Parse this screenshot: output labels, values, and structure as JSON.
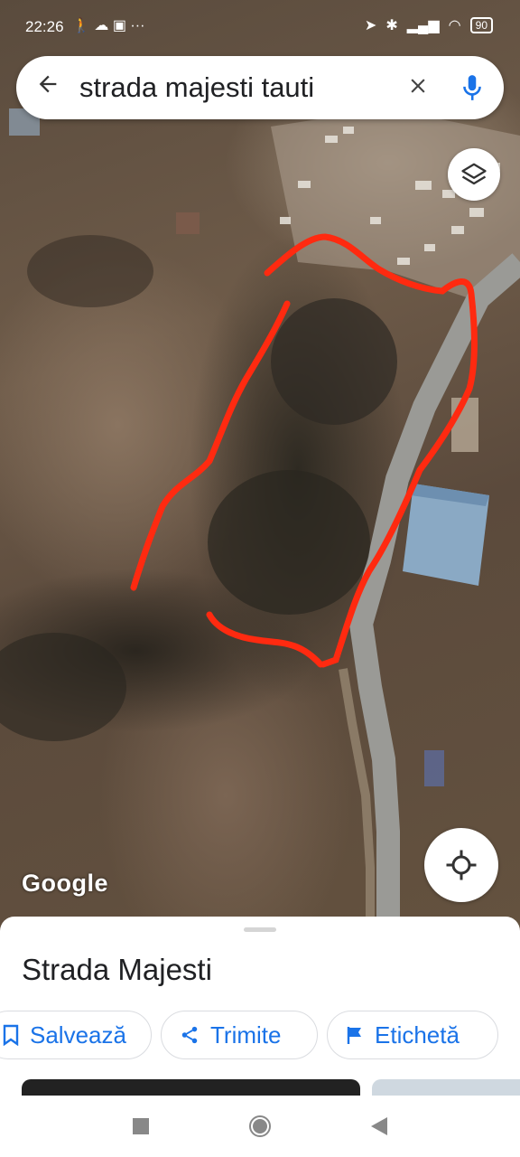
{
  "status_bar": {
    "time": "22:26",
    "battery": "90"
  },
  "search": {
    "query": "strada majesti tauti"
  },
  "map": {
    "attribution": "Google"
  },
  "place_sheet": {
    "title": "Strada Majesti",
    "actions": {
      "save": "Salvează",
      "share": "Trimite",
      "label": "Etichetă"
    }
  },
  "colors": {
    "accent": "#1a73e8",
    "drawn_outline": "#ff2a10"
  }
}
